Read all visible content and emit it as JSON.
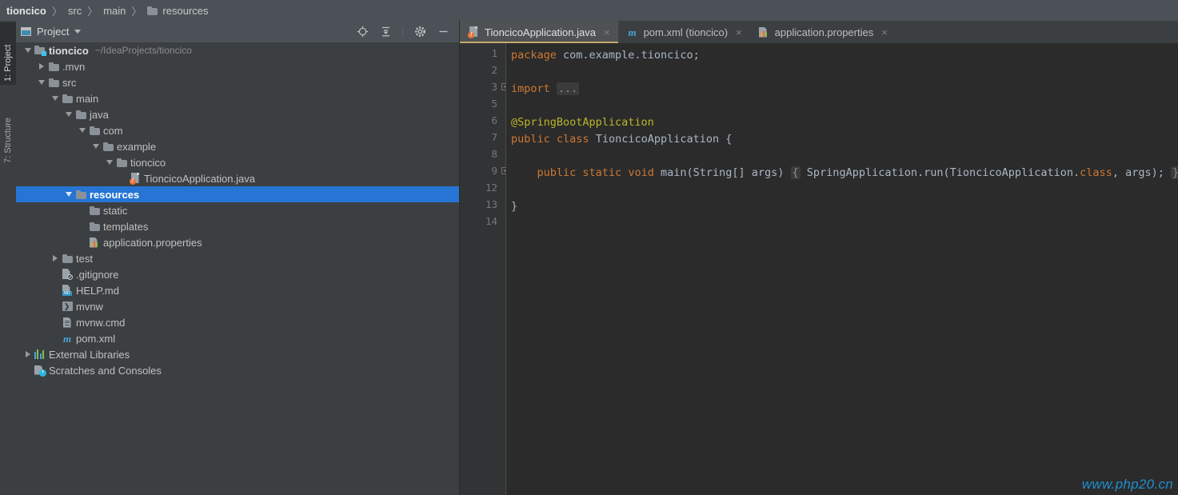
{
  "breadcrumb": {
    "items": [
      {
        "label": "tioncico",
        "bold": true,
        "icon": null
      },
      {
        "label": "src",
        "bold": false,
        "icon": null
      },
      {
        "label": "main",
        "bold": false,
        "icon": null
      },
      {
        "label": "resources",
        "bold": false,
        "icon": "folder-icon"
      }
    ],
    "separator": "〉"
  },
  "tool_strip": {
    "tabs": [
      {
        "label": "1: Project",
        "selected": true
      },
      {
        "label": "7: Structure",
        "selected": false
      }
    ]
  },
  "project_panel": {
    "title": "Project",
    "title_icon": "project-view-icon",
    "dropdown_icon": "chevron-down-icon",
    "toolbar": [
      {
        "name": "locate-file-icon",
        "glyph": "⊕"
      },
      {
        "name": "collapse-all-icon",
        "glyph": "≡"
      },
      {
        "name": "settings-gear-icon",
        "glyph": "⚙"
      },
      {
        "name": "hide-panel-icon",
        "glyph": "—"
      }
    ],
    "tree": [
      {
        "label": "tioncico",
        "path": "~/IdeaProjects/tioncico",
        "depth": 0,
        "arrow": "down",
        "icon": "module-folder-icon",
        "bold": true,
        "selected": false
      },
      {
        "label": ".mvn",
        "path": "",
        "depth": 1,
        "arrow": "right",
        "icon": "folder-icon",
        "bold": false,
        "selected": false
      },
      {
        "label": "src",
        "path": "",
        "depth": 1,
        "arrow": "down",
        "icon": "folder-icon",
        "bold": false,
        "selected": false
      },
      {
        "label": "main",
        "path": "",
        "depth": 2,
        "arrow": "down",
        "icon": "folder-icon",
        "bold": false,
        "selected": false
      },
      {
        "label": "java",
        "path": "",
        "depth": 3,
        "arrow": "down",
        "icon": "folder-icon",
        "bold": false,
        "selected": false
      },
      {
        "label": "com",
        "path": "",
        "depth": 4,
        "arrow": "down",
        "icon": "folder-icon",
        "bold": false,
        "selected": false
      },
      {
        "label": "example",
        "path": "",
        "depth": 5,
        "arrow": "down",
        "icon": "folder-icon",
        "bold": false,
        "selected": false
      },
      {
        "label": "tioncico",
        "path": "",
        "depth": 6,
        "arrow": "down",
        "icon": "folder-icon",
        "bold": false,
        "selected": false
      },
      {
        "label": "TioncicoApplication.java",
        "path": "",
        "depth": 7,
        "arrow": "none",
        "icon": "java-class-icon",
        "bold": false,
        "selected": false
      },
      {
        "label": "resources",
        "path": "",
        "depth": 3,
        "arrow": "down",
        "icon": "folder-icon",
        "bold": false,
        "selected": true
      },
      {
        "label": "static",
        "path": "",
        "depth": 4,
        "arrow": "none",
        "icon": "folder-icon",
        "bold": false,
        "selected": false
      },
      {
        "label": "templates",
        "path": "",
        "depth": 4,
        "arrow": "none",
        "icon": "folder-icon",
        "bold": false,
        "selected": false
      },
      {
        "label": "application.properties",
        "path": "",
        "depth": 4,
        "arrow": "none",
        "icon": "properties-file-icon",
        "bold": false,
        "selected": false
      },
      {
        "label": "test",
        "path": "",
        "depth": 2,
        "arrow": "right",
        "icon": "folder-icon",
        "bold": false,
        "selected": false
      },
      {
        "label": ".gitignore",
        "path": "",
        "depth": 2,
        "arrow": "none",
        "icon": "gitignore-file-icon",
        "bold": false,
        "selected": false
      },
      {
        "label": "HELP.md",
        "path": "",
        "depth": 2,
        "arrow": "none",
        "icon": "markdown-file-icon",
        "bold": false,
        "selected": false
      },
      {
        "label": "mvnw",
        "path": "",
        "depth": 2,
        "arrow": "none",
        "icon": "shell-script-icon",
        "bold": false,
        "selected": false
      },
      {
        "label": "mvnw.cmd",
        "path": "",
        "depth": 2,
        "arrow": "none",
        "icon": "text-file-icon",
        "bold": false,
        "selected": false
      },
      {
        "label": "pom.xml",
        "path": "",
        "depth": 2,
        "arrow": "none",
        "icon": "maven-file-icon",
        "bold": false,
        "selected": false
      },
      {
        "label": "External Libraries",
        "path": "",
        "depth": 0,
        "arrow": "right",
        "icon": "external-libraries-icon",
        "bold": false,
        "selected": false
      },
      {
        "label": "Scratches and Consoles",
        "path": "",
        "depth": 0,
        "arrow": "none",
        "icon": "scratches-icon",
        "bold": false,
        "selected": false
      }
    ]
  },
  "editor": {
    "tabs": [
      {
        "label": "TioncicoApplication.java",
        "icon": "java-class-icon",
        "active": true,
        "close": "×"
      },
      {
        "label": "pom.xml (tioncico)",
        "icon": "maven-file-icon",
        "active": false,
        "close": "×"
      },
      {
        "label": "application.properties",
        "icon": "properties-file-icon",
        "active": false,
        "close": "×"
      }
    ],
    "line_numbers": [
      "1",
      "2",
      "3",
      "5",
      "6",
      "7",
      "8",
      "9",
      "12",
      "13",
      "14"
    ],
    "fold_markers": [
      "+",
      "+"
    ],
    "lines": [
      {
        "num": "1",
        "tokens": [
          {
            "t": "package ",
            "c": "kw"
          },
          {
            "t": "com.example.tioncico;",
            "c": "txtw"
          }
        ]
      },
      {
        "num": "2",
        "tokens": []
      },
      {
        "num": "3",
        "tokens": [
          {
            "t": "import ",
            "c": "kw"
          },
          {
            "t": "...",
            "c": "fold"
          }
        ]
      },
      {
        "num": "5",
        "tokens": []
      },
      {
        "num": "6",
        "tokens": [
          {
            "t": "@SpringBootApplication",
            "c": "ann"
          }
        ]
      },
      {
        "num": "7",
        "tokens": [
          {
            "t": "public ",
            "c": "kw"
          },
          {
            "t": "class ",
            "c": "kw"
          },
          {
            "t": "TioncicoApplication {",
            "c": "txtw"
          }
        ]
      },
      {
        "num": "8",
        "tokens": []
      },
      {
        "num": "9",
        "tokens": [
          {
            "t": "    ",
            "c": "txtw"
          },
          {
            "t": "public ",
            "c": "kw"
          },
          {
            "t": "static ",
            "c": "kw"
          },
          {
            "t": "void ",
            "c": "kw"
          },
          {
            "t": "main(String[] args) ",
            "c": "txtw"
          },
          {
            "t": "{",
            "c": "fold"
          },
          {
            "t": " SpringApplication.run(TioncicoApplication.",
            "c": "txtw"
          },
          {
            "t": "class",
            "c": "kw"
          },
          {
            "t": ", args); ",
            "c": "txtw"
          },
          {
            "t": "}",
            "c": "fold"
          }
        ]
      },
      {
        "num": "12",
        "tokens": []
      },
      {
        "num": "13",
        "tokens": [
          {
            "t": "}",
            "c": "txtw"
          }
        ]
      },
      {
        "num": "14",
        "tokens": []
      }
    ]
  },
  "watermark": {
    "text": "www.php20.cn"
  },
  "colors": {
    "selection_blue": "#2675d4",
    "editor_bg": "#2b2b2b",
    "panel_bg": "#3c3f41",
    "header_bg": "#4b5157",
    "keyword_orange": "#cc7832",
    "annotation_yellow": "#bbb529",
    "text_grey": "#a9b7c6",
    "watermark_blue": "#1e8fd0",
    "active_tab_underline": "#c4a86a"
  }
}
